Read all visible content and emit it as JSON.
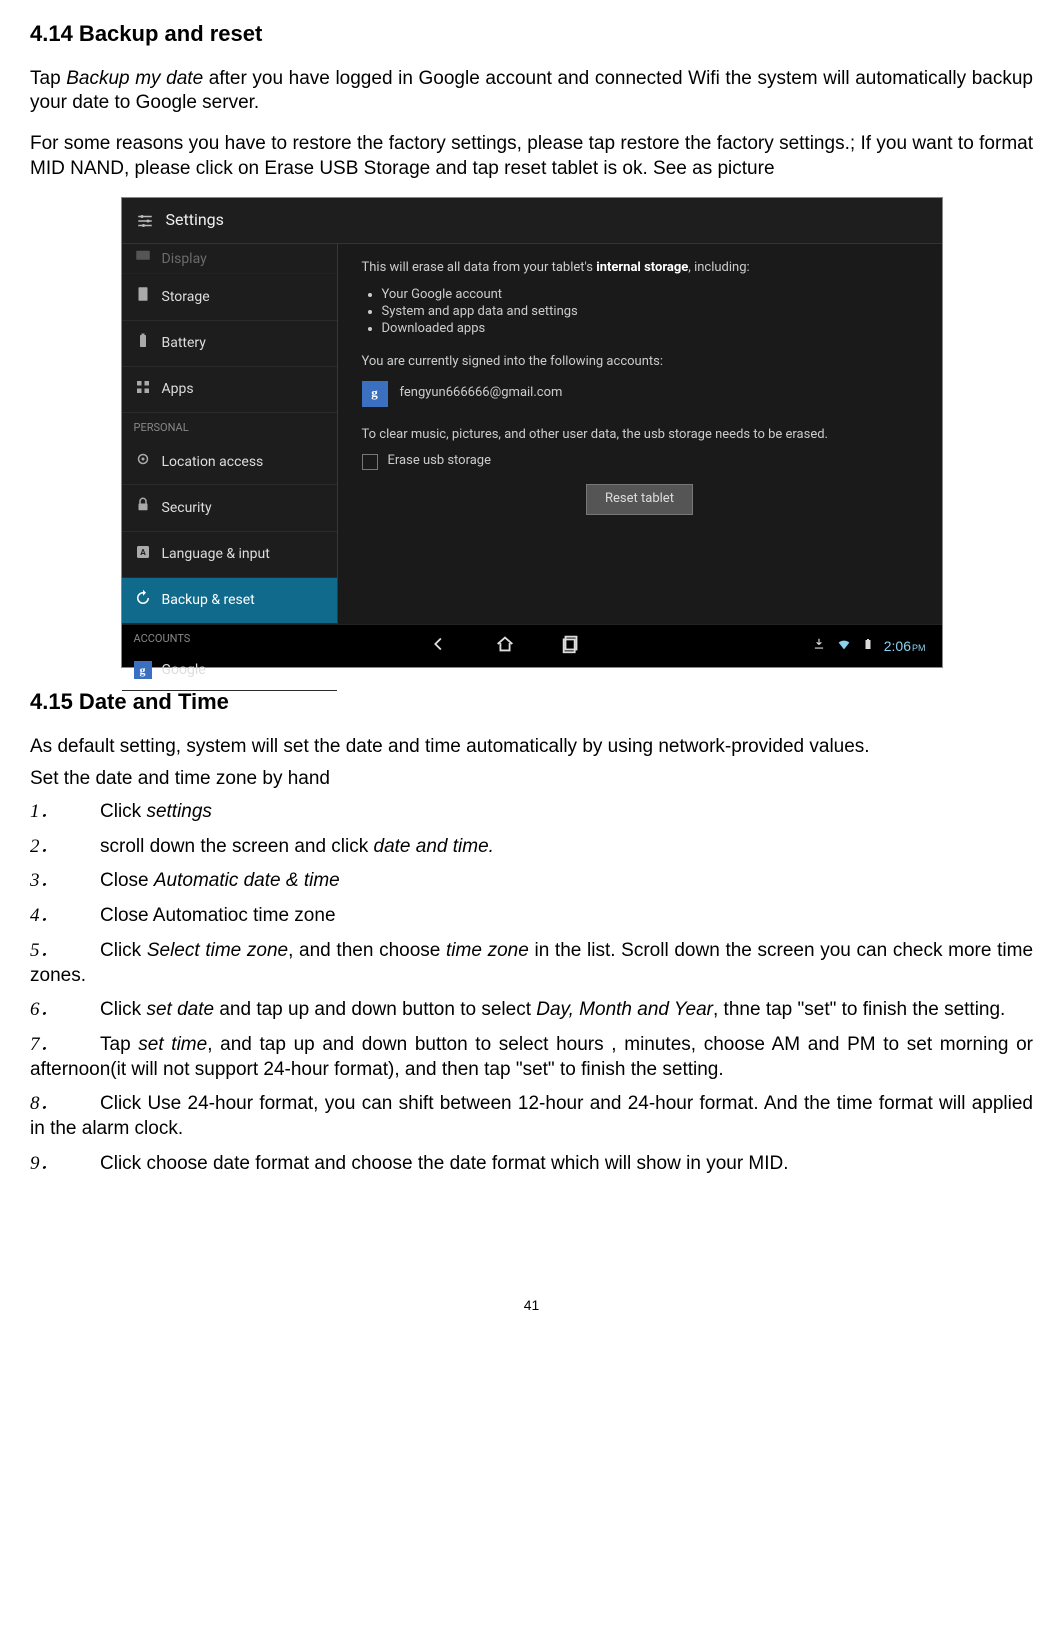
{
  "section414": {
    "heading": "4.14 Backup and reset",
    "para1_pre": "Tap ",
    "para1_italic": "Backup my date",
    "para1_post": " after you have logged in Google account and connected Wifi the system will automatically backup your date to Google server.",
    "para2": "For some reasons you have to restore the factory settings, please tap restore the factory settings.; If you want to format MID NAND, please click on Erase USB Storage and tap reset tablet is ok. See as picture"
  },
  "screenshot": {
    "title": "Settings",
    "sidebar_items": [
      {
        "label": "Display",
        "icon": "display"
      },
      {
        "label": "Storage",
        "icon": "storage"
      },
      {
        "label": "Battery",
        "icon": "battery"
      },
      {
        "label": "Apps",
        "icon": "apps"
      }
    ],
    "sidebar_cat1": "PERSONAL",
    "sidebar_personal": [
      {
        "label": "Location access",
        "icon": "location"
      },
      {
        "label": "Security",
        "icon": "lock"
      },
      {
        "label": "Language & input",
        "icon": "lang"
      },
      {
        "label": "Backup & reset",
        "icon": "backup",
        "selected": true
      }
    ],
    "sidebar_cat2": "ACCOUNTS",
    "sidebar_accounts": [
      {
        "label": "Google",
        "icon": "google"
      }
    ],
    "main_intro_pre": "This will erase all data from your tablet's ",
    "main_intro_bold": "internal storage",
    "main_intro_post": ", including:",
    "bullets": [
      "Your Google account",
      "System and app data and settings",
      "Downloaded apps"
    ],
    "signed_into": "You are currently signed into the following accounts:",
    "account_email": "fengyun666666@gmail.com",
    "clear_text": "To clear music, pictures, and other user data, the usb storage needs to be erased.",
    "erase_label": "Erase usb storage",
    "reset_button": "Reset tablet",
    "time": "2:06",
    "time_suffix": "PM"
  },
  "section415": {
    "heading": "4.15 Date and Time",
    "intro": "As default setting, system will set the date and time automatically by using network-provided values.",
    "set_hand": "Set the date and time zone by hand",
    "items": [
      {
        "num": "1．",
        "pre": "Click ",
        "it": "settings",
        "post": ""
      },
      {
        "num": "2．",
        "pre": "scroll down the screen and click ",
        "it": "date and time.",
        "post": ""
      },
      {
        "num": "3．",
        "pre": "Close ",
        "it": "Automatic date & time",
        "post": ""
      },
      {
        "num": "4．",
        "pre": "Close Automatioc time zone",
        "it": "",
        "post": ""
      },
      {
        "num": "5．",
        "pre": "Click ",
        "it": "Select time zone",
        "post": ", and then choose ",
        "it2": "time zone",
        "post2": " in the list. Scroll down the screen you can check more time zones."
      },
      {
        "num": "6．",
        "pre": "Click ",
        "it": "set date",
        "post": " and tap up and down button to select ",
        "it2": "Day, Month and Year",
        "post2": ", thne tap \"set\" to finish the setting."
      },
      {
        "num": "7．",
        "pre": "Tap ",
        "it": "set time",
        "post": ", and tap up and down button to select hours , minutes, choose AM and PM to set morning or afternoon(it will not support 24-hour format), and then tap \"set\" to finish the setting."
      },
      {
        "num": "8．",
        "pre": "Click Use 24-hour format, you can shift between 12-hour and 24-hour format. And the time format will applied in the alarm clock.",
        "it": "",
        "post": ""
      },
      {
        "num": "9．",
        "pre": "Click choose date format and choose the date format which will show in your MID.",
        "it": "",
        "post": ""
      }
    ]
  },
  "page_number": "41"
}
